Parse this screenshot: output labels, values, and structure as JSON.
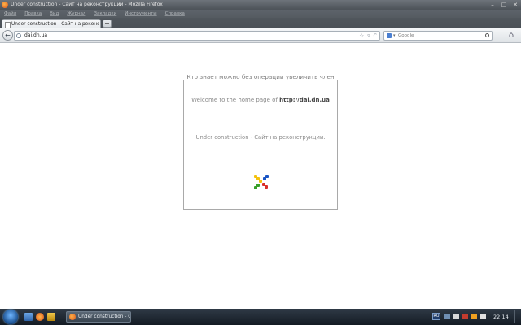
{
  "window": {
    "title": "Under construction - Сайт на реконструкции - Mozilla Firefox",
    "controls": [
      "–",
      "□",
      "✕"
    ]
  },
  "menubar": {
    "items": [
      "Файл",
      "Правка",
      "Вид",
      "Журнал",
      "Закладки",
      "Инструменты",
      "Справка"
    ]
  },
  "tabs": {
    "active_label": "Under construction - Сайт на реконструкции",
    "new_tab_label": "+"
  },
  "navbar": {
    "back_label": "←",
    "url": "dai.dn.ua",
    "url_actions": [
      "☆",
      "▿",
      "C"
    ],
    "search_placeholder": "Google",
    "home_label": "⌂"
  },
  "page": {
    "promo_prefix": "Кто знает можно без операции ",
    "promo_link": "увеличить член",
    "welcome_prefix": "Welcome to the home page of ",
    "welcome_site": "http://dai.dn.ua",
    "under_construction": "Under construction - Сайт на реконструкции."
  },
  "taskbar": {
    "task_label": "Under construction - С...",
    "language": "RU",
    "clock": "22:14"
  },
  "colors": {
    "logo_yellow": "#f4c20d",
    "logo_blue": "#1a56c4",
    "logo_green": "#3aa02a",
    "logo_red": "#d9302a"
  }
}
